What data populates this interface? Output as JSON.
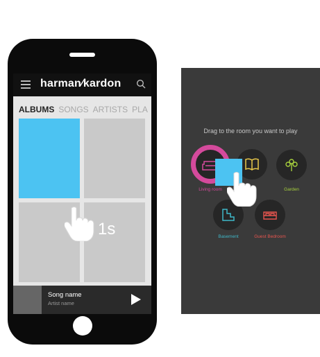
{
  "app": {
    "brand": "harman∕kardon"
  },
  "tabs": [
    {
      "label": "ALBUMS",
      "active": true
    },
    {
      "label": "SONGS",
      "active": false
    },
    {
      "label": "ARTISTS",
      "active": false
    },
    {
      "label": "PLA",
      "active": false
    }
  ],
  "gesture": {
    "hold_label": "1s"
  },
  "player": {
    "song": "Song name",
    "artist": "Artist name"
  },
  "rooms_panel": {
    "instruction": "Drag to the room you want to play",
    "rooms": [
      {
        "label": "Living room",
        "color": "#d44a9c",
        "icon": "sofa-icon"
      },
      {
        "label": "",
        "color": "#e8c84a",
        "icon": "book-icon"
      },
      {
        "label": "Garden",
        "color": "#a6cf3d",
        "icon": "plant-icon"
      },
      {
        "label": "Basement",
        "color": "#3fb8c9",
        "icon": "stairs-icon"
      },
      {
        "label": "Guest Bedroom",
        "color": "#e8554f",
        "icon": "bed-icon"
      }
    ]
  },
  "colors": {
    "accent": "#4cc3f2",
    "phone_body": "#0b0b0b",
    "panel_bg": "#3a3a3a"
  }
}
